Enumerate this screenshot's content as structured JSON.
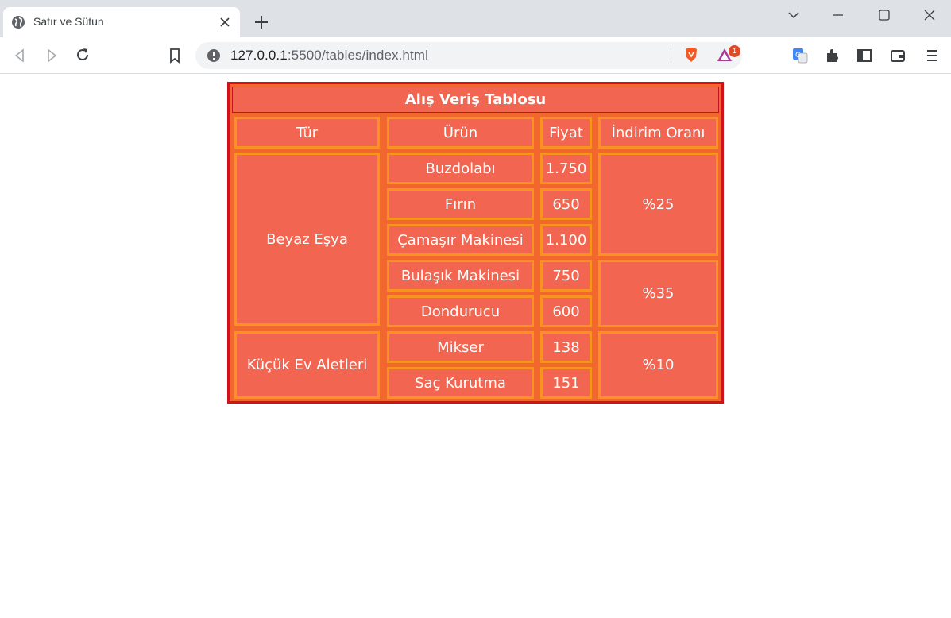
{
  "browser": {
    "tab_title": "Satır ve Sütun",
    "url_host": "127.0.0.1",
    "url_rest": ":5500/tables/index.html",
    "extension_badge": "1"
  },
  "table": {
    "caption": "Alış Veriş Tablosu",
    "headers": [
      "Tür",
      "Ürün",
      "Fiyat",
      "İndirim Oranı"
    ],
    "groups": [
      {
        "category": "Beyaz Eşya"
      },
      {
        "category": "Küçük Ev Aletleri"
      }
    ],
    "rows": [
      {
        "product": "Buzdolabı",
        "price": "1.750"
      },
      {
        "product": "Fırın",
        "price": "650"
      },
      {
        "product": "Çamaşır Makinesi",
        "price": "1.100"
      },
      {
        "product": "Bulaşık Makinesi",
        "price": "750"
      },
      {
        "product": "Dondurucu",
        "price": "600"
      },
      {
        "product": "Mikser",
        "price": "138"
      },
      {
        "product": "Saç Kurutma",
        "price": "151"
      }
    ],
    "discounts": [
      "%25",
      "%35",
      "%10"
    ]
  },
  "colors": {
    "cell_fill": "#f26551",
    "cell_border": "#f7931e",
    "table_border": "#d0121b",
    "text": "#ffffff"
  }
}
